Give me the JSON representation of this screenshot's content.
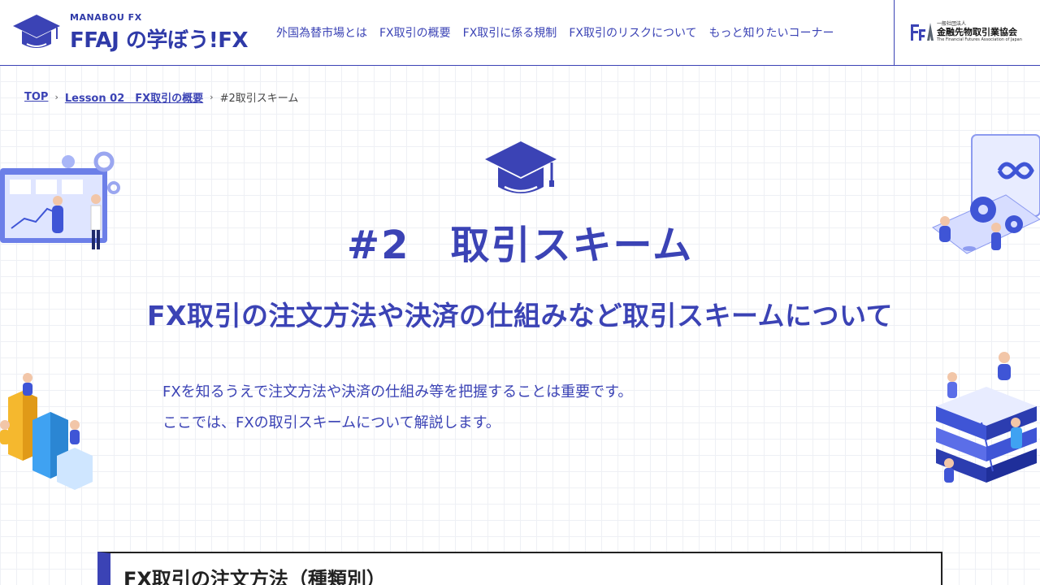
{
  "header": {
    "logo_small": "MANABOU FX",
    "logo_big": "FFAJ の学ぼう!FX",
    "nav": [
      "外国為替市場とは",
      "FX取引の概要",
      "FX取引に係る規制",
      "FX取引のリスクについて",
      "もっと知りたいコーナー"
    ],
    "association": {
      "small": "一般社団法人",
      "name": "金融先物取引業協会",
      "english": "The Financial Futures Association of Japan"
    }
  },
  "breadcrumb": {
    "items": [
      "TOP",
      "Lesson 02　FX取引の概要"
    ],
    "current": "#2取引スキーム"
  },
  "hero": {
    "title": "#2　取引スキーム",
    "subtitle": "FX取引の注文方法や決済の仕組みなど取引スキームについて",
    "intro": [
      "FXを知るうえで注文方法や決済の仕組み等を把握することは重要です。",
      "ここでは、FXの取引スキームについて解説します。"
    ]
  },
  "section": {
    "title": "FX取引の注文方法（種類別）"
  },
  "colors": {
    "accent": "#3b43b5",
    "illustration_blue": "#3f55d6",
    "illustration_yellow": "#f5b82e"
  }
}
